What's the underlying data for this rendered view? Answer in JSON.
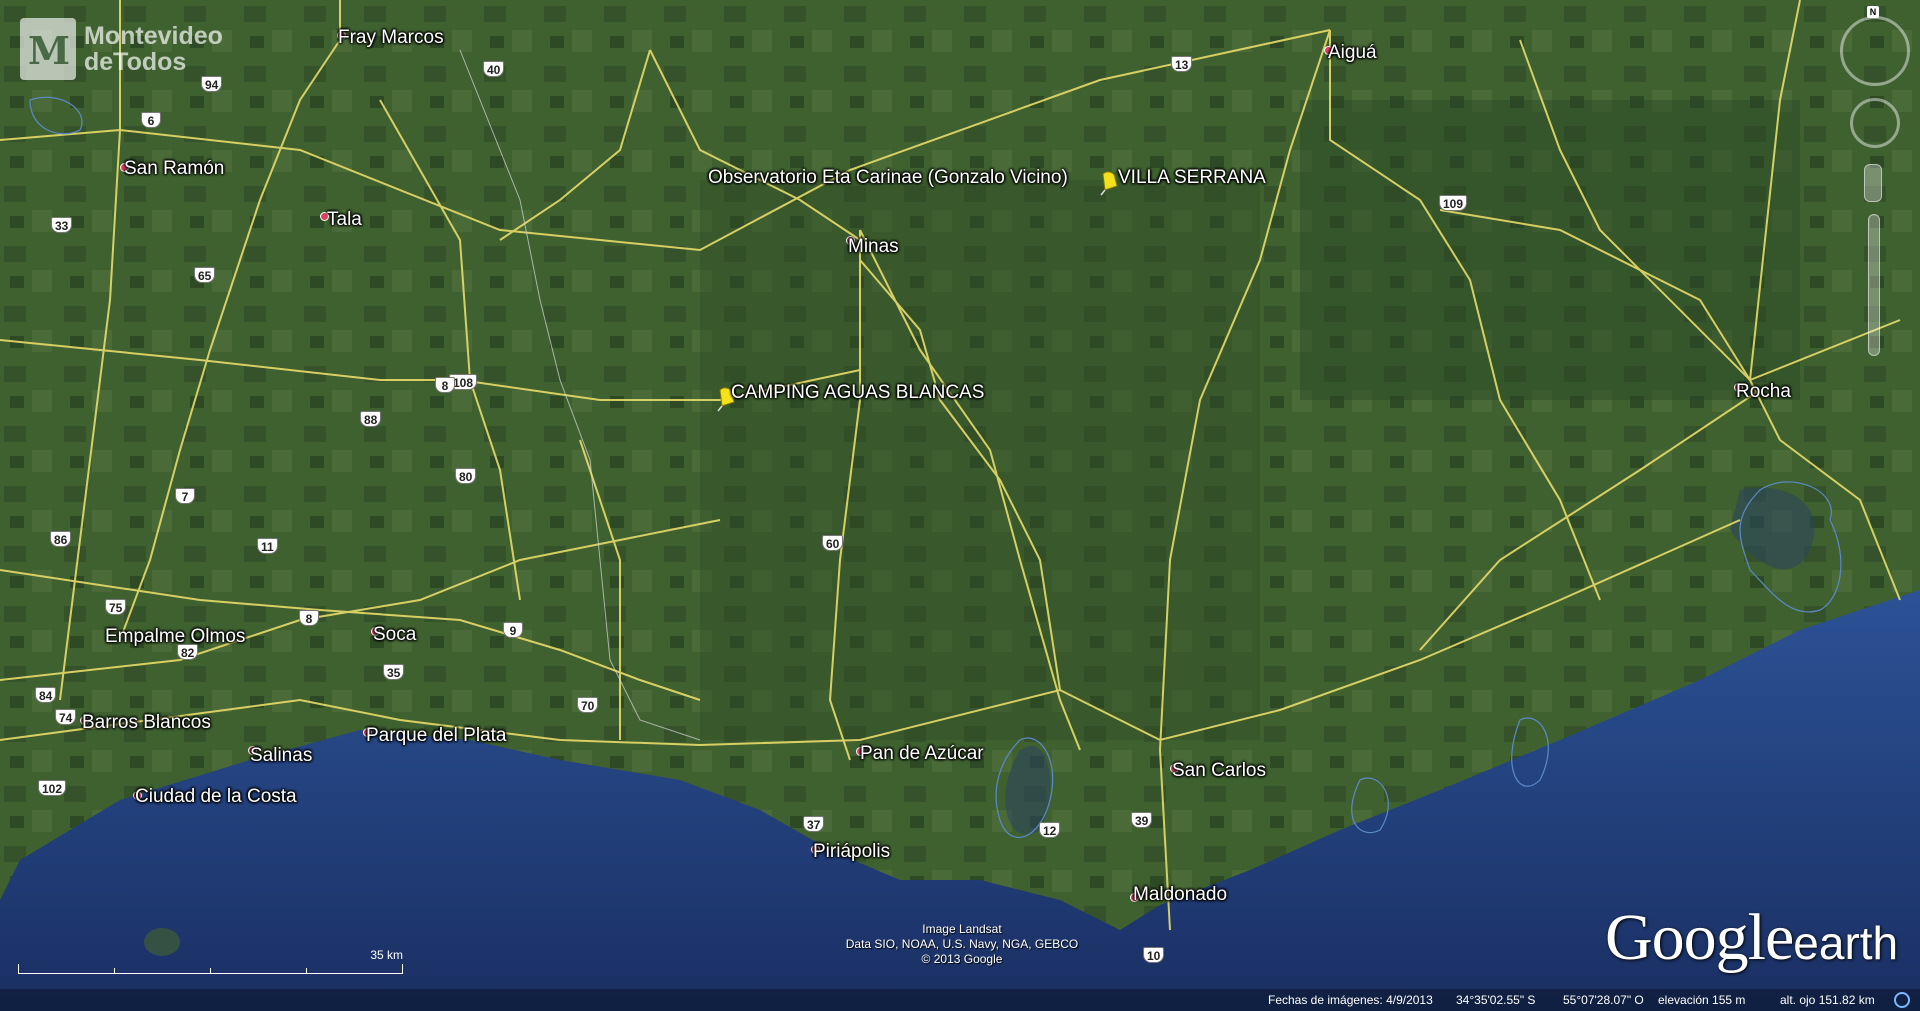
{
  "logo": {
    "line1": "Montevideo",
    "line2": "deTodos",
    "mark": "M"
  },
  "places": [
    {
      "id": "fray-marcos",
      "name": "Fray Marcos"
    },
    {
      "id": "aigua",
      "name": "Aiguá"
    },
    {
      "id": "san-ramon",
      "name": "San Ramón"
    },
    {
      "id": "tala",
      "name": "Tala"
    },
    {
      "id": "minas",
      "name": "Minas"
    },
    {
      "id": "rocha",
      "name": "Rocha"
    },
    {
      "id": "empalme-olmos",
      "name": "Empalme Olmos"
    },
    {
      "id": "soca",
      "name": "Soca"
    },
    {
      "id": "barros-blancos",
      "name": "Barros Blancos"
    },
    {
      "id": "salinas",
      "name": "Salinas"
    },
    {
      "id": "parque-del-plata",
      "name": "Parque del Plata"
    },
    {
      "id": "pan-de-azucar",
      "name": "Pan de Azúcar"
    },
    {
      "id": "san-carlos",
      "name": "San Carlos"
    },
    {
      "id": "ciudad-de-la-costa",
      "name": "Ciudad de la Costa"
    },
    {
      "id": "piriapolis",
      "name": "Piriápolis"
    },
    {
      "id": "maldonado",
      "name": "Maldonado"
    }
  ],
  "placemarks": [
    {
      "id": "observatorio",
      "name": "Observatorio Eta Carinae (Gonzalo Vicino)"
    },
    {
      "id": "villa-serrana",
      "name": "VILLA SERRANA"
    },
    {
      "id": "camping",
      "name": "CAMPING AGUAS BLANCAS"
    }
  ],
  "routes": [
    "94",
    "6",
    "40",
    "13",
    "33",
    "65",
    "109",
    "108",
    "8",
    "88",
    "80",
    "7",
    "86",
    "11",
    "60",
    "75",
    "8",
    "82",
    "9",
    "35",
    "84",
    "74",
    "70",
    "102",
    "37",
    "12",
    "39",
    "10"
  ],
  "credits": {
    "line1": "Image Landsat",
    "line2": "Data SIO, NOAA, U.S. Navy, NGA, GEBCO",
    "line3": "© 2013 Google"
  },
  "scale": {
    "label": "35 km"
  },
  "brand": {
    "google": "Google",
    "earth": "earth"
  },
  "status": {
    "imagery_date": "Fechas de imágenes: 4/9/2013",
    "lat": "34°35'02.55\" S",
    "lon": "55°07'28.07\" O",
    "elevation": "elevación   155 m",
    "eye_alt": "alt. ojo 151.82 km"
  },
  "colors": {
    "land": "#3a5a2e",
    "sea": "#23437e",
    "road": "#e8dc6a",
    "place_dot": "#e04060",
    "pin": "#f3e21a"
  }
}
